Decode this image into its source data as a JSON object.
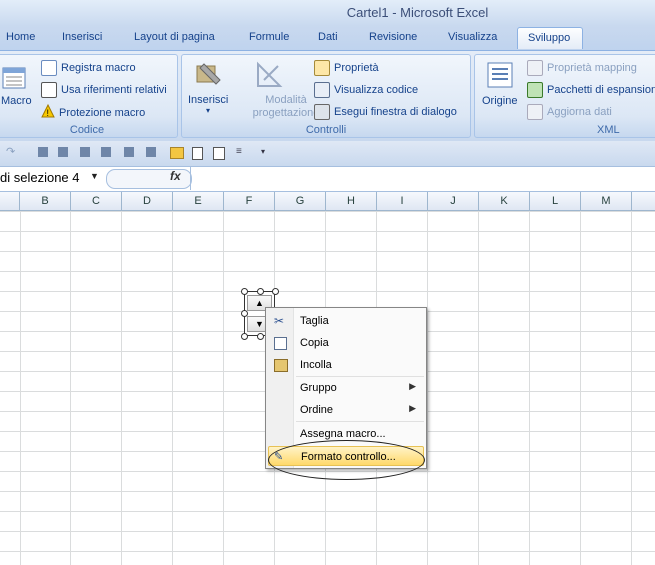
{
  "window": {
    "title": "Cartel1 - Microsoft Excel"
  },
  "tabs": [
    "Home",
    "Inserisci",
    "Layout di pagina",
    "Formule",
    "Dati",
    "Revisione",
    "Visualizza",
    "Sviluppo"
  ],
  "ribbon": {
    "codice": {
      "label": "Codice",
      "macro": "Macro",
      "registra": "Registra macro",
      "usa_rif": "Usa riferimenti relativi",
      "protezione": "Protezione macro"
    },
    "controlli": {
      "label": "Controlli",
      "inserisci": "Inserisci",
      "modalita": "Modalità progettazione",
      "proprieta": "Proprietà",
      "visualizza_codice": "Visualizza codice",
      "esegui": "Esegui finestra di dialogo"
    },
    "xml": {
      "label": "XML",
      "origine": "Origine",
      "proprieta_mapping": "Proprietà mapping",
      "pacchetti": "Pacchetti di espansione",
      "aggiorna": "Aggiorna dati"
    }
  },
  "formula_bar": {
    "name_box": "di selezione 4",
    "fx": "fx",
    "value": ""
  },
  "columns": [
    "B",
    "C",
    "D",
    "E",
    "F",
    "G",
    "H",
    "I",
    "J",
    "K",
    "L",
    "M"
  ],
  "context_menu": {
    "items": [
      {
        "label": "Taglia",
        "icon": "scissors-icon"
      },
      {
        "label": "Copia",
        "icon": "copy-icon"
      },
      {
        "label": "Incolla",
        "icon": "paste-icon"
      },
      {
        "label": "Gruppo",
        "submenu": true
      },
      {
        "label": "Ordine",
        "submenu": true
      },
      {
        "label": "Assegna macro..."
      },
      {
        "label": "Formato controllo...",
        "icon": "format-control-icon",
        "highlighted": true
      }
    ]
  },
  "colors": {
    "accent": "#15428b",
    "highlight": "#ffd96b"
  }
}
